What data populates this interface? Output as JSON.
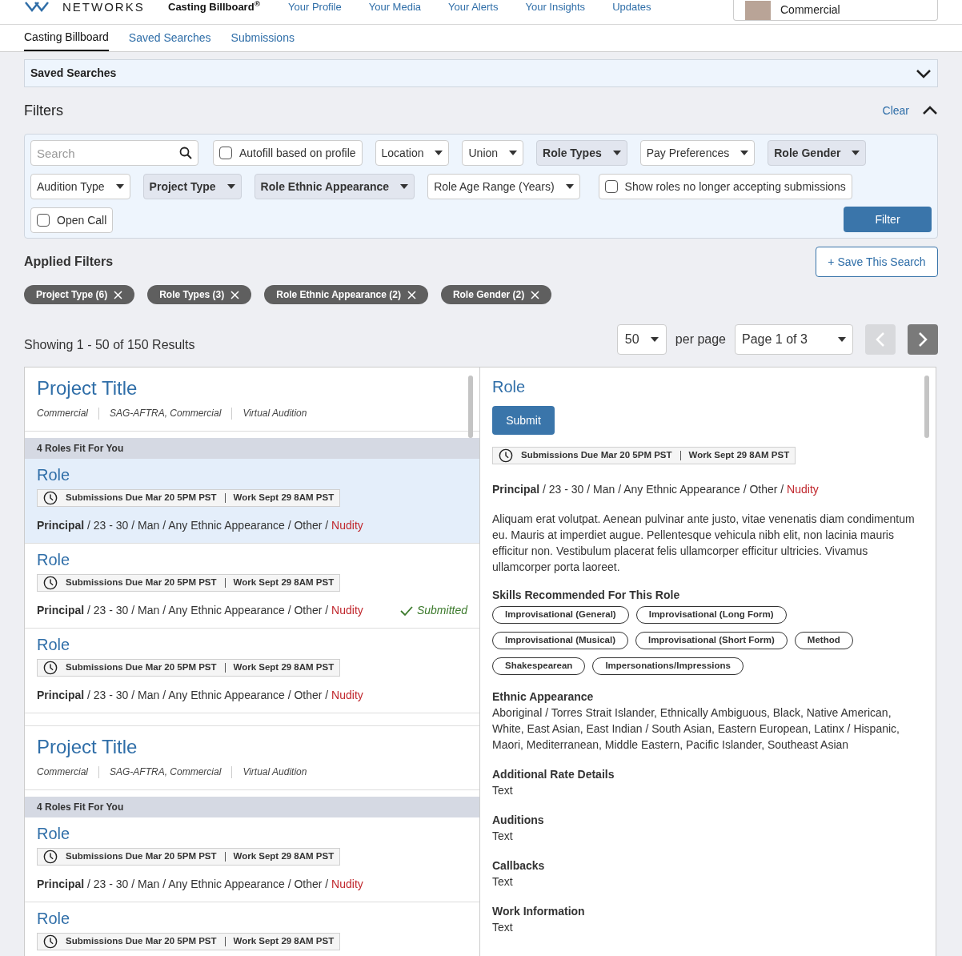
{
  "header": {
    "logo_text": "NETWORKS",
    "brand": "Casting Billboard$^{®}$",
    "nav": [
      "Your Profile",
      "Your Media",
      "Your Alerts",
      "Your Insights",
      "Updates"
    ],
    "account": "Commercial"
  },
  "tabs": [
    {
      "label": "Casting Billboard",
      "selected": true
    },
    {
      "label": "Saved Searches",
      "selected": false
    },
    {
      "label": "Submissions",
      "selected": false
    }
  ],
  "saved_searches": {
    "title": "Saved Searches",
    "expanded": false
  },
  "filters": {
    "title": "Filters",
    "clear": "Clear",
    "expanded": true,
    "search_placeholder": "Search",
    "controls": [
      {
        "kind": "checkbox",
        "label": "Autofill based on profile",
        "checked": false
      },
      {
        "kind": "dropdown",
        "label": "Location",
        "active": false
      },
      {
        "kind": "dropdown",
        "label": "Union",
        "active": false
      },
      {
        "kind": "dropdown",
        "label": "Role Types",
        "active": true
      },
      {
        "kind": "dropdown",
        "label": "Pay Preferences",
        "active": false
      },
      {
        "kind": "dropdown",
        "label": "Role Gender",
        "active": true
      },
      {
        "kind": "dropdown",
        "label": "Audition Type",
        "active": false
      },
      {
        "kind": "dropdown",
        "label": "Project Type",
        "active": true
      },
      {
        "kind": "dropdown",
        "label": "Role Ethnic Appearance",
        "active": true
      },
      {
        "kind": "dropdown",
        "label": "Role Age Range (Years)",
        "active": false
      },
      {
        "kind": "checkbox",
        "label": "Show roles no longer accepting submissions",
        "checked": false
      },
      {
        "kind": "checkbox",
        "label": "Open Call",
        "checked": false
      }
    ],
    "filter_button": "Filter"
  },
  "applied_filters": {
    "title": "Applied Filters",
    "save_button": "+ Save This Search",
    "chips": [
      "Project Type (6)",
      "Role Types (3)",
      "Role Ethnic Appearance (2)",
      "Role Gender (2)"
    ]
  },
  "results": {
    "summary": "Showing 1 - 50 of 150 Results",
    "per_page": "50",
    "per_page_label": "per page",
    "page": "Page 1 of 3",
    "prev_disabled": true,
    "next_disabled": false
  },
  "projects": [
    {
      "title": "Project Title",
      "meta": [
        "Commercial",
        "SAG-AFTRA, Commercial",
        "Virtual Audition"
      ],
      "roles_fit": "4 Roles Fit For You",
      "roles": [
        {
          "title": "Role",
          "due": "Submissions Due Mar 20 5PM PST",
          "work": "Work Sept 29 8AM PST",
          "type": "Principal",
          "details": " / 23 - 30 / Man / Any Ethnic Appearance / Other / ",
          "flag": "Nudity",
          "selected": true
        },
        {
          "title": "Role",
          "due": "Submissions Due Mar 20 5PM PST",
          "work": "Work Sept 29 8AM PST",
          "type": "Principal",
          "details": " / 23 - 30 / Man / Any Ethnic Appearance / Other / ",
          "flag": "Nudity",
          "selected": false,
          "status": "Submitted"
        },
        {
          "title": "Role",
          "due": "Submissions Due Mar 20 5PM PST",
          "work": "Work Sept 29 8AM PST",
          "type": "Principal",
          "details": " / 23 - 30 / Man / Any Ethnic Appearance / Other / ",
          "flag": "Nudity",
          "selected": false
        }
      ]
    },
    {
      "title": "Project Title",
      "meta": [
        "Commercial",
        "SAG-AFTRA, Commercial",
        "Virtual Audition"
      ],
      "roles_fit": "4 Roles Fit For You",
      "roles": [
        {
          "title": "Role",
          "due": "Submissions Due Mar 20 5PM PST",
          "work": "Work Sept 29 8AM PST",
          "type": "Principal",
          "details": " / 23 - 30 / Man / Any Ethnic Appearance / Other / ",
          "flag": "Nudity",
          "selected": false
        },
        {
          "title": "Role",
          "due": "Submissions Due Mar 20 5PM PST",
          "work": "Work Sept 29 8AM PST",
          "selected": false
        }
      ]
    }
  ],
  "detail": {
    "title": "Role",
    "submit": "Submit",
    "due": "Submissions Due Mar 20 5PM PST",
    "work": "Work Sept 29 8AM PST",
    "type": "Principal",
    "details": " / 23 - 30 / Man / Any Ethnic Appearance / Other / ",
    "flag": "Nudity",
    "description": "Aliquam erat volutpat. Aenean pulvinar ante justo, vitae venenatis diam condimentum eu. Mauris at imperdiet augue. Pellentesque vehicula nibh elit, non lacinia mauris efficitur non. Vestibulum placerat felis ullamcorper efficitur ultricies. Vivamus ullamcorper porta laoreet.",
    "skills_heading": "Skills Recommended For This Role",
    "skills": [
      "Improvisational (General)",
      "Improvisational (Long Form)",
      "Improvisational (Musical)",
      "Improvisational (Short Form)",
      "Method",
      "Shakespearean",
      "Impersonations/Impressions"
    ],
    "sections": [
      {
        "heading": "Ethnic Appearance",
        "text": "Aboriginal / Torres Strait Islander, Ethnically Ambiguous, Black, Native American, White, East Asian, East Indian / South Asian, Eastern European, Latinx / Hispanic, Maori, Mediterranean, Middle Eastern, Pacific Islander, Southeast Asian"
      },
      {
        "heading": "Additional Rate Details",
        "text": "Text"
      },
      {
        "heading": "Auditions",
        "text": "Text"
      },
      {
        "heading": "Callbacks",
        "text": "Text"
      },
      {
        "heading": "Work Information",
        "text": "Text"
      }
    ]
  }
}
